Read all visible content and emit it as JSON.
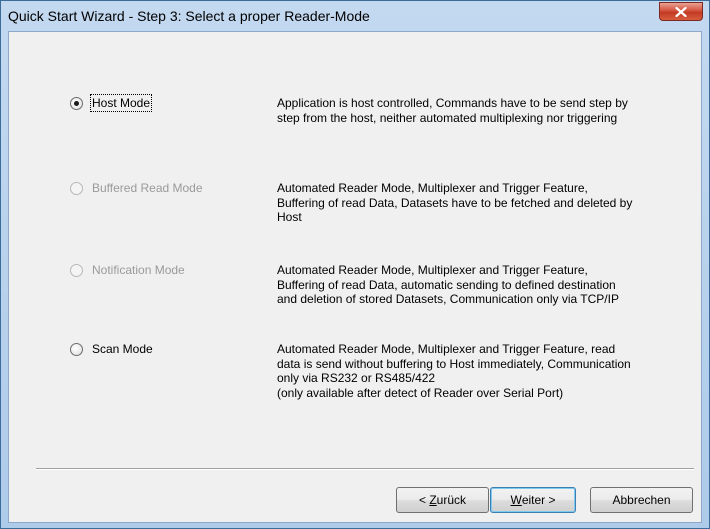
{
  "window": {
    "title": "Quick Start Wizard - Step 3: Select a proper Reader-Mode"
  },
  "modes": [
    {
      "label": "Host Mode",
      "selected": true,
      "enabled": true,
      "description": "Application is host controlled, Commands have to be send step by step from the host, neither automated multiplexing nor triggering"
    },
    {
      "label": "Buffered Read Mode",
      "selected": false,
      "enabled": false,
      "description": "Automated Reader Mode, Multiplexer and Trigger Feature, Buffering of read Data, Datasets have to be fetched and deleted by Host"
    },
    {
      "label": "Notification Mode",
      "selected": false,
      "enabled": false,
      "description": "Automated Reader Mode, Multiplexer and Trigger Feature, Buffering of read Data, automatic sending to defined destination and deletion of stored Datasets, Communication only via TCP/IP"
    },
    {
      "label": "Scan Mode",
      "selected": false,
      "enabled": true,
      "description": "Automated Reader Mode, Multiplexer and Trigger Feature, read data is send without buffering to Host immediately, Communication only via RS232 or RS485/422",
      "note": "(only available after detect of Reader over Serial Port)"
    }
  ],
  "buttons": {
    "back": {
      "prefix": "< ",
      "accel": "Z",
      "rest": "urück"
    },
    "next": {
      "accel": "W",
      "rest": "eiter >"
    },
    "cancel": "Abbrechen"
  }
}
